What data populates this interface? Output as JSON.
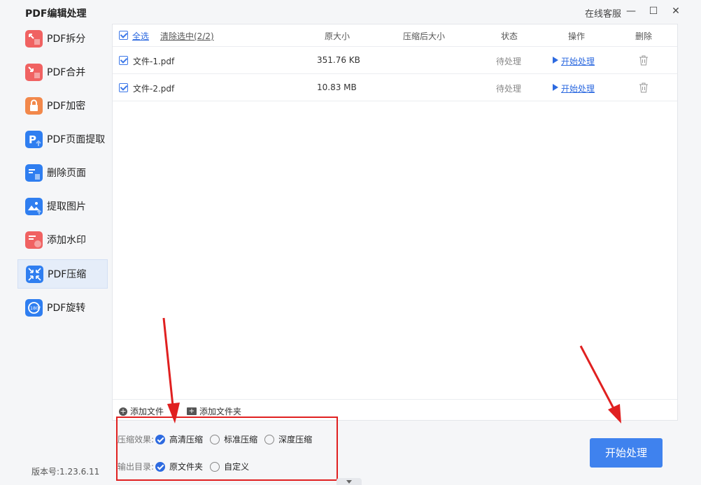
{
  "window": {
    "title": "PDF编辑处理",
    "support": "在线客服",
    "minimize": "—",
    "maximize": "☐",
    "close": "✕"
  },
  "sidebar": {
    "items": [
      {
        "label": "PDF拆分",
        "icon": "split-icon",
        "color": "#f06262"
      },
      {
        "label": "PDF合并",
        "icon": "merge-icon",
        "color": "#f06262"
      },
      {
        "label": "PDF加密",
        "icon": "lock-icon",
        "color": "#f2884b"
      },
      {
        "label": "PDF页面提取",
        "icon": "page-extract-icon",
        "color": "#2f7ef0"
      },
      {
        "label": "删除页面",
        "icon": "delete-page-icon",
        "color": "#2f7ef0"
      },
      {
        "label": "提取图片",
        "icon": "image-extract-icon",
        "color": "#2f7ef0"
      },
      {
        "label": "添加水印",
        "icon": "watermark-icon",
        "color": "#f06262"
      },
      {
        "label": "PDF压缩",
        "icon": "compress-icon",
        "color": "#2f7ef0",
        "active": true
      },
      {
        "label": "PDF旋转",
        "icon": "rotate-icon",
        "color": "#2f7ef0"
      }
    ],
    "version": "版本号:1.23.6.11"
  },
  "table": {
    "select_all": "全选",
    "clear_selected": "清除选中(2/2)",
    "headers": {
      "original_size": "原大小",
      "compressed_size": "压缩后大小",
      "status": "状态",
      "action": "操作",
      "delete": "删除"
    },
    "rows": [
      {
        "name": "文件-1.pdf",
        "size": "351.76 KB",
        "compressed": "",
        "status": "待处理",
        "action": "开始处理"
      },
      {
        "name": "文件-2.pdf",
        "size": "10.83 MB",
        "compressed": "",
        "status": "待处理",
        "action": "开始处理"
      }
    ]
  },
  "add_bar": {
    "add_file": "添加文件",
    "add_folder": "添加文件夹"
  },
  "options": {
    "compression_label": "压缩效果:",
    "compression_options": [
      "高清压缩",
      "标准压缩",
      "深度压缩"
    ],
    "compression_selected": "高清压缩",
    "output_label": "输出目录:",
    "output_options": [
      "原文件夹",
      "自定义"
    ],
    "output_selected": "原文件夹"
  },
  "start_button": "开始处理",
  "colors": {
    "accent": "#3f82ee",
    "annotation": "#e02020"
  }
}
